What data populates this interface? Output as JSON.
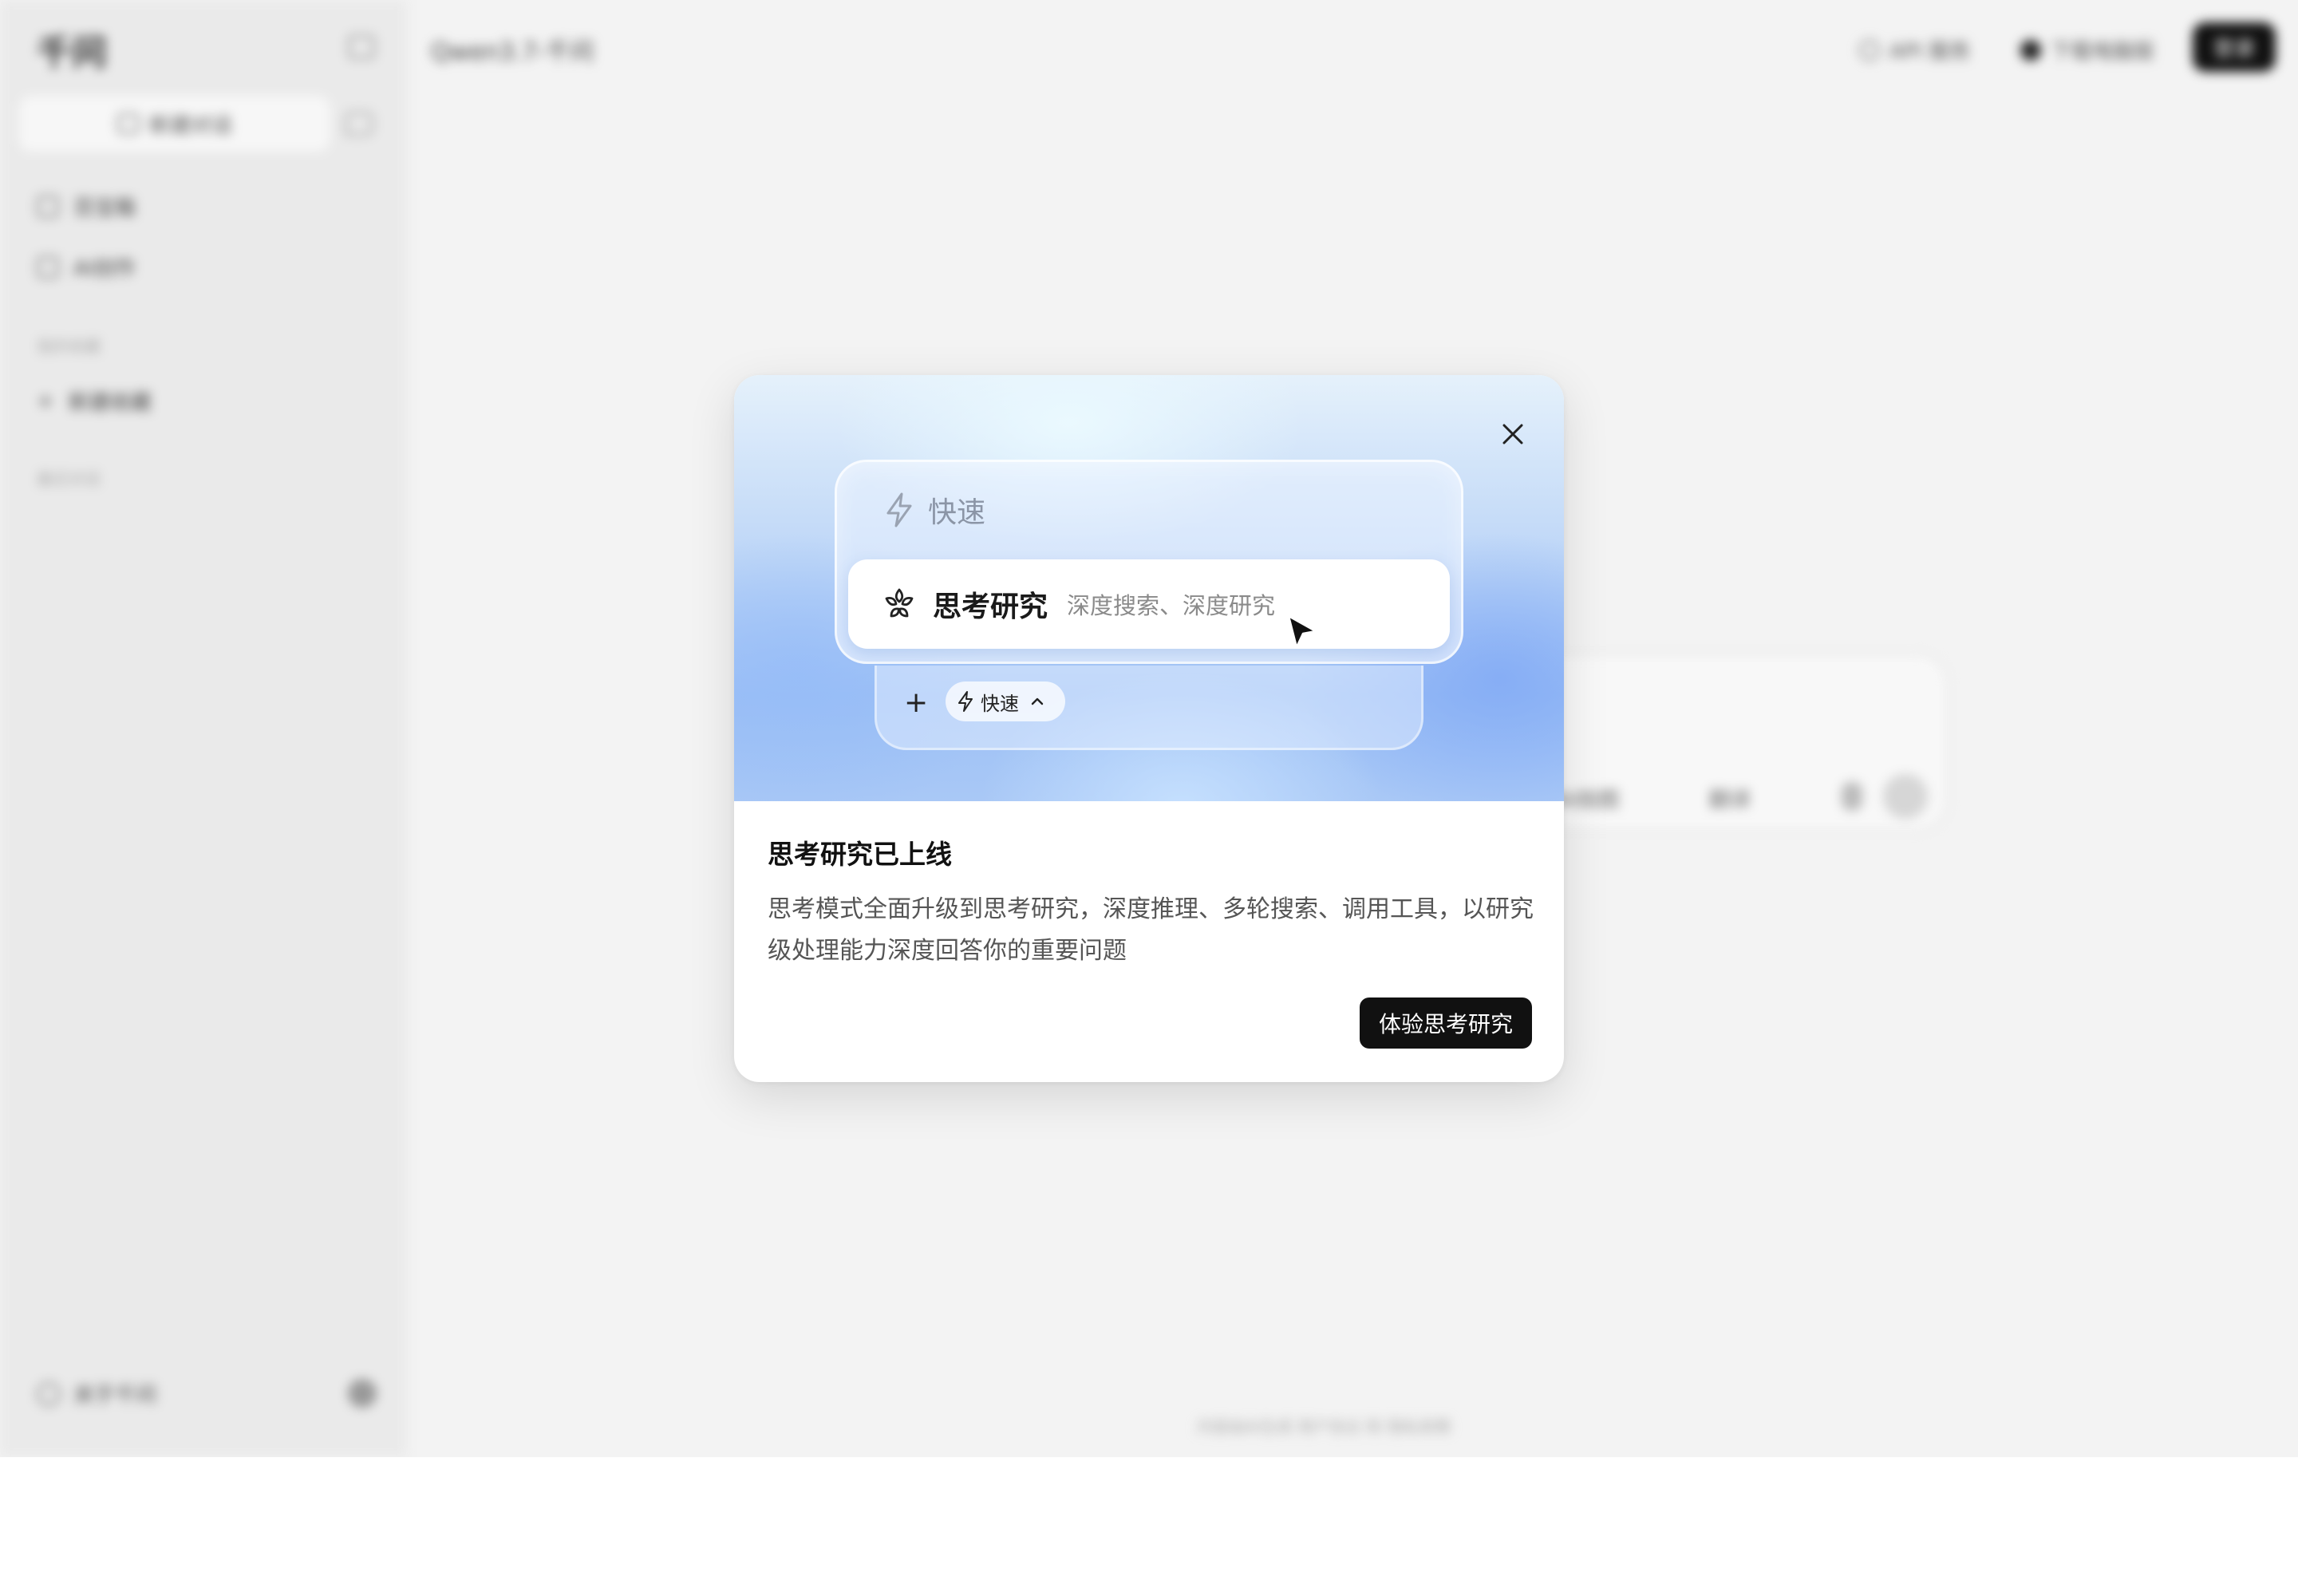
{
  "app": {
    "logo": "千问",
    "new_chat_label": "新建对话",
    "nav": [
      {
        "label": "百宝箱"
      },
      {
        "label": "AI创作"
      }
    ],
    "section_pinned": "我的收藏",
    "pinned_add_label": "新建收藏",
    "section_recent": "最近对话",
    "about_label": "关于千问",
    "model_selector": "Qwen3.7-千问",
    "api_label": "API 服务",
    "download_label": "下载电脑版",
    "login_label": "登录",
    "input_tools": [
      "AI拍图",
      "翻译"
    ],
    "footer_note": "内容由AI生成 用户协议 和 隐私政策"
  },
  "modal": {
    "mode_fast_label": "快速",
    "mode_think_label": "思考研究",
    "mode_think_sub": "深度搜索、深度研究",
    "chip_label": "快速",
    "title": "思考研究已上线",
    "description": "思考模式全面升级到思考研究，深度推理、多轮搜索、调用工具，以研究级处理能力深度回答你的重要问题",
    "cta_label": "体验思考研究"
  }
}
